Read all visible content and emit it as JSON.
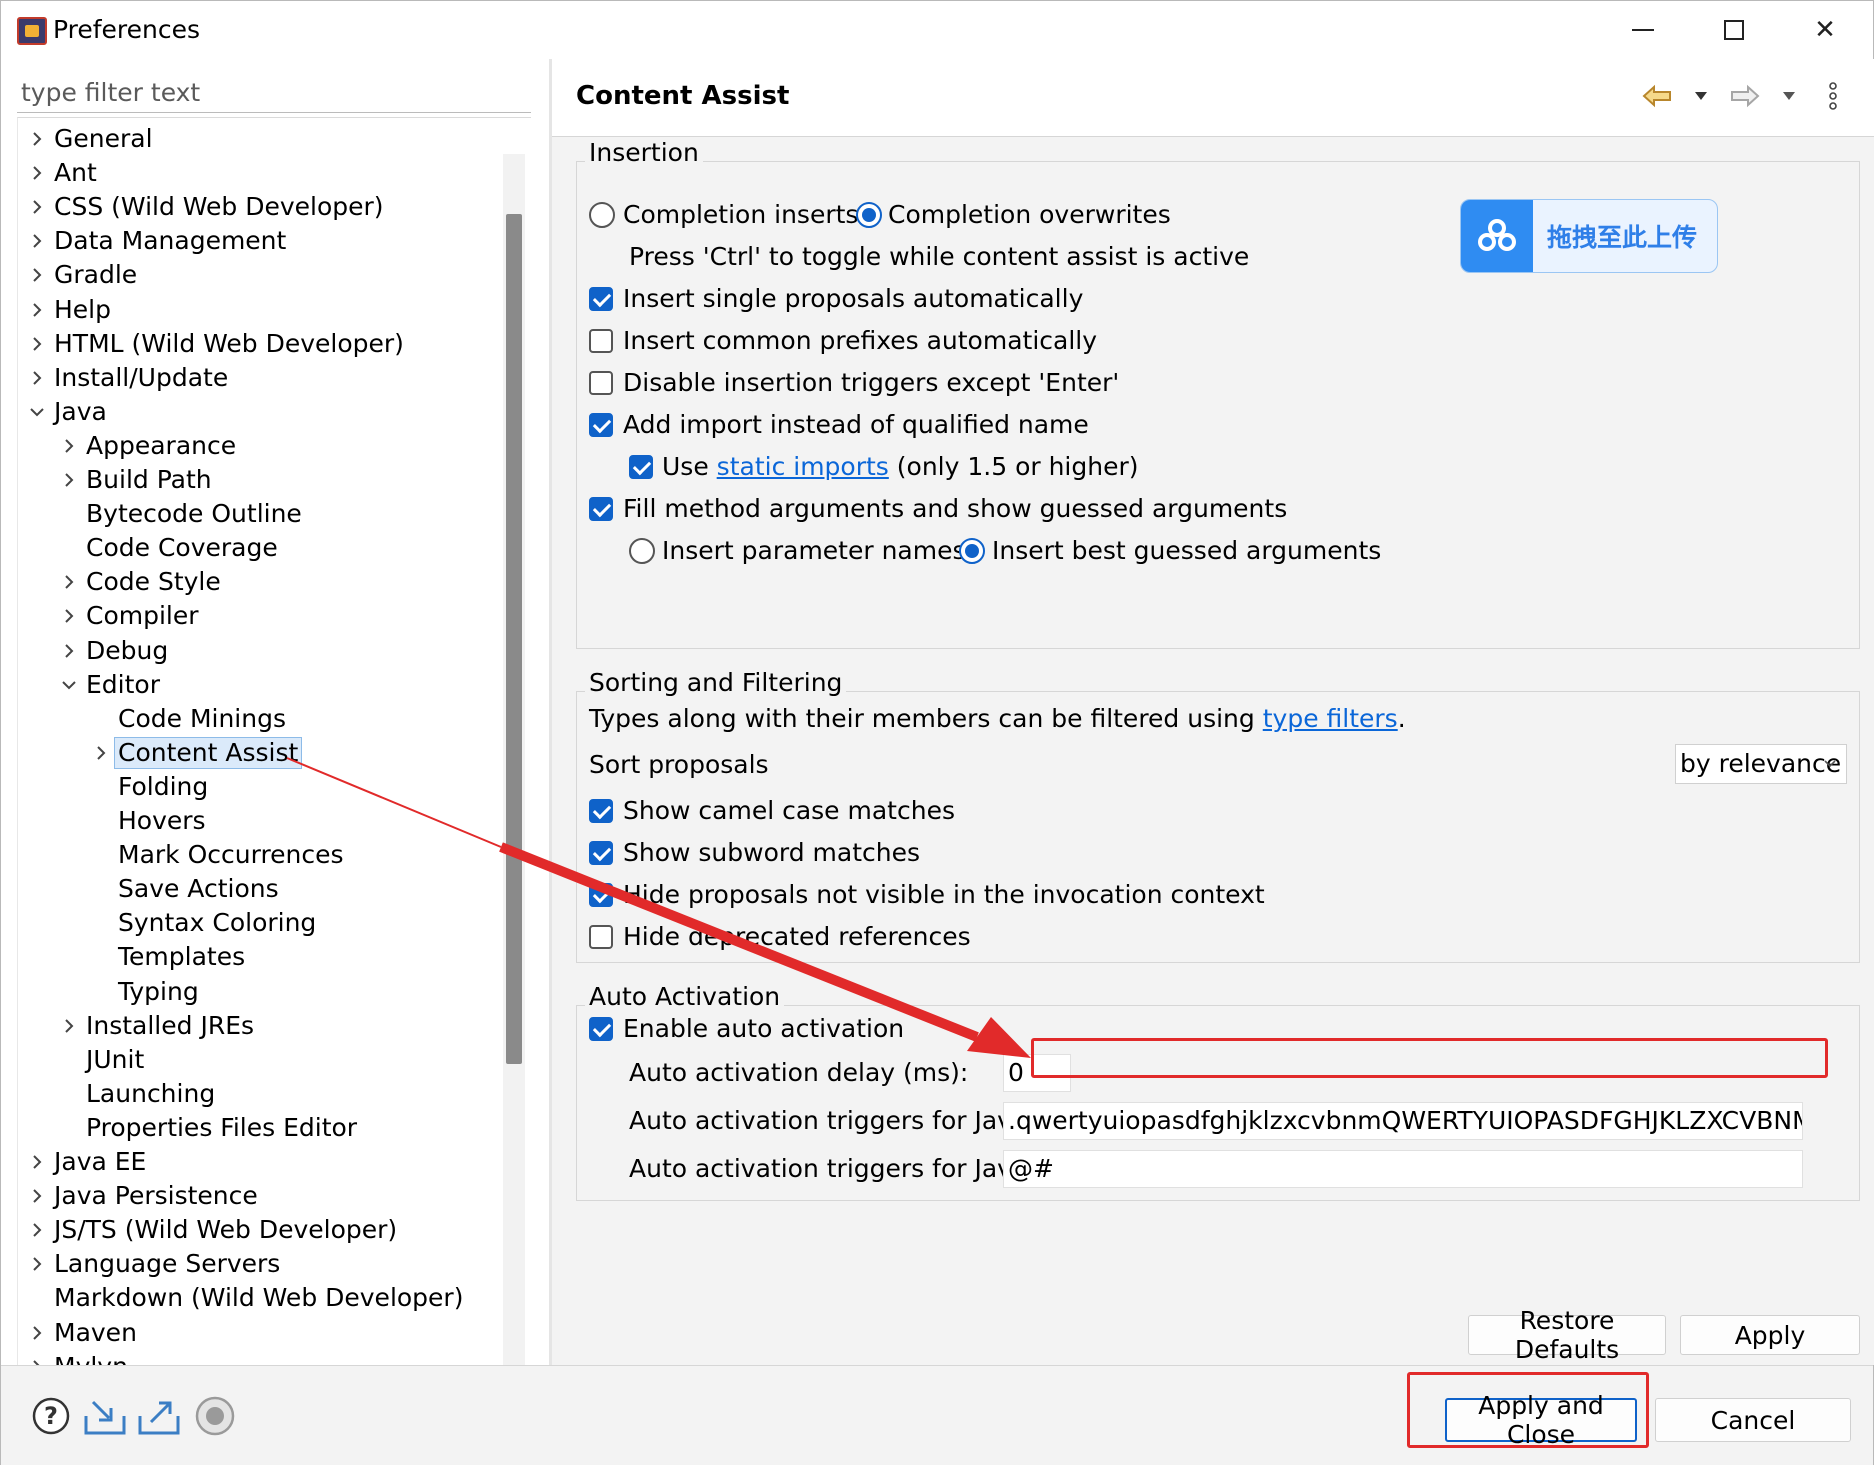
{
  "window": {
    "title": "Preferences",
    "minimize_icon": "minimize-icon",
    "maximize_icon": "maximize-icon",
    "close_icon": "close-icon",
    "close_glyph": "✕"
  },
  "sidebar": {
    "filter_placeholder": "type filter text",
    "items": [
      {
        "label": "General",
        "level": 0,
        "expander": "collapsed"
      },
      {
        "label": "Ant",
        "level": 0,
        "expander": "collapsed"
      },
      {
        "label": "CSS (Wild Web Developer)",
        "level": 0,
        "expander": "collapsed"
      },
      {
        "label": "Data Management",
        "level": 0,
        "expander": "collapsed"
      },
      {
        "label": "Gradle",
        "level": 0,
        "expander": "collapsed"
      },
      {
        "label": "Help",
        "level": 0,
        "expander": "collapsed"
      },
      {
        "label": "HTML (Wild Web Developer)",
        "level": 0,
        "expander": "collapsed"
      },
      {
        "label": "Install/Update",
        "level": 0,
        "expander": "collapsed"
      },
      {
        "label": "Java",
        "level": 0,
        "expander": "expanded"
      },
      {
        "label": "Appearance",
        "level": 1,
        "expander": "collapsed"
      },
      {
        "label": "Build Path",
        "level": 1,
        "expander": "collapsed"
      },
      {
        "label": "Bytecode Outline",
        "level": 1,
        "expander": "none"
      },
      {
        "label": "Code Coverage",
        "level": 1,
        "expander": "none"
      },
      {
        "label": "Code Style",
        "level": 1,
        "expander": "collapsed"
      },
      {
        "label": "Compiler",
        "level": 1,
        "expander": "collapsed"
      },
      {
        "label": "Debug",
        "level": 1,
        "expander": "collapsed"
      },
      {
        "label": "Editor",
        "level": 1,
        "expander": "expanded"
      },
      {
        "label": "Code Minings",
        "level": 2,
        "expander": "none"
      },
      {
        "label": "Content Assist",
        "level": 2,
        "expander": "collapsed",
        "selected": true
      },
      {
        "label": "Folding",
        "level": 2,
        "expander": "none"
      },
      {
        "label": "Hovers",
        "level": 2,
        "expander": "none"
      },
      {
        "label": "Mark Occurrences",
        "level": 2,
        "expander": "none"
      },
      {
        "label": "Save Actions",
        "level": 2,
        "expander": "none"
      },
      {
        "label": "Syntax Coloring",
        "level": 2,
        "expander": "none"
      },
      {
        "label": "Templates",
        "level": 2,
        "expander": "none"
      },
      {
        "label": "Typing",
        "level": 2,
        "expander": "none"
      },
      {
        "label": "Installed JREs",
        "level": 1,
        "expander": "collapsed"
      },
      {
        "label": "JUnit",
        "level": 1,
        "expander": "none"
      },
      {
        "label": "Launching",
        "level": 1,
        "expander": "none"
      },
      {
        "label": "Properties Files Editor",
        "level": 1,
        "expander": "none"
      },
      {
        "label": "Java EE",
        "level": 0,
        "expander": "collapsed"
      },
      {
        "label": "Java Persistence",
        "level": 0,
        "expander": "collapsed"
      },
      {
        "label": "JS/TS (Wild Web Developer)",
        "level": 0,
        "expander": "collapsed"
      },
      {
        "label": "Language Servers",
        "level": 0,
        "expander": "collapsed"
      },
      {
        "label": "Markdown (Wild Web Developer)",
        "level": 0,
        "expander": "none"
      },
      {
        "label": "Maven",
        "level": 0,
        "expander": "collapsed"
      },
      {
        "label": "Mylyn",
        "level": 0,
        "expander": "collapsed"
      }
    ]
  },
  "page": {
    "title": "Content Assist",
    "nav_icons": [
      "back-arrow-icon",
      "back-menu-icon",
      "forward-arrow-icon",
      "forward-menu-icon",
      "more-options-icon"
    ],
    "insertion": {
      "title": "Insertion",
      "completion_inserts": "Completion inserts",
      "completion_overwrites": "Completion overwrites",
      "toggle_hint": "Press 'Ctrl' to toggle while content assist is active",
      "insert_single": "Insert single proposals automatically",
      "insert_common": "Insert common prefixes automatically",
      "disable_triggers": "Disable insertion triggers except 'Enter'",
      "add_import": "Add import instead of qualified name",
      "use_prefix": "Use",
      "static_imports_link": "static imports",
      "use_suffix": "(only 1.5 or higher)",
      "fill_method_args": "Fill method arguments and show guessed arguments",
      "insert_param_names": "Insert parameter names",
      "insert_best_guessed": "Insert best guessed arguments"
    },
    "sorting": {
      "title": "Sorting and Filtering",
      "types_text": "Types along with their members can be filtered using",
      "type_filters_link": "type filters",
      "types_period": ".",
      "sort_proposals_label": "Sort proposals",
      "sort_value": "by relevance",
      "show_camel": "Show camel case matches",
      "show_subword": "Show subword matches",
      "hide_not_visible": "Hide proposals not visible in the invocation context",
      "hide_deprecated": "Hide deprecated references"
    },
    "auto_activation": {
      "title": "Auto Activation",
      "enable": "Enable auto activation",
      "delay_label": "Auto activation delay (ms):",
      "delay_value": "0",
      "java_label": "Auto activation triggers for Java:",
      "java_value": ".qwertyuiopasdfghjklzxcvbnmQWERTYUIOPASDFGHJKLZXCVBNM",
      "javadoc_label": "Auto activation triggers for Javadoc:",
      "javadoc_value": "@#"
    },
    "restore_defaults": "Restore Defaults",
    "apply": "Apply"
  },
  "upload_badge": {
    "text": "拖拽至此上传",
    "icon": "cloud-upload-icon"
  },
  "footer": {
    "icons": [
      "help-icon",
      "import-icon",
      "export-icon",
      "record-icon"
    ],
    "apply_and_close": "Apply and Close",
    "cancel": "Cancel"
  },
  "colors": {
    "accent": "#0f62c9",
    "annotation": "#e12a2a",
    "link": "#0a66d8"
  }
}
